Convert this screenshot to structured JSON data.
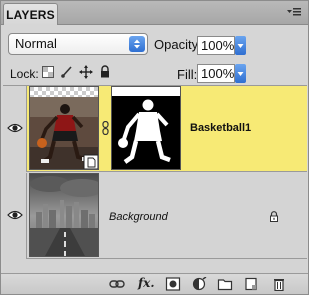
{
  "panel": {
    "title": "LAYERS",
    "menu_icon": "panel-menu-icon"
  },
  "blend": {
    "mode": "Normal",
    "opacity_label": "Opacity:",
    "opacity_value": "100%"
  },
  "lock": {
    "label": "Lock:",
    "icons": [
      "lock-transparency-icon",
      "lock-image-icon",
      "lock-position-icon",
      "lock-all-icon"
    ],
    "fill_label": "Fill:",
    "fill_value": "100%"
  },
  "layers": [
    {
      "name": "Basketball1",
      "selected": true,
      "visible": true,
      "has_mask": true,
      "linked": true
    },
    {
      "name": "Background",
      "selected": false,
      "visible": true,
      "locked": true
    }
  ],
  "toolbar": {
    "icons": [
      "link-layers-icon",
      "fx-icon",
      "add-mask-icon",
      "adjustment-layer-icon",
      "new-group-icon",
      "new-layer-icon",
      "trash-icon"
    ],
    "fx_label": "fx."
  }
}
